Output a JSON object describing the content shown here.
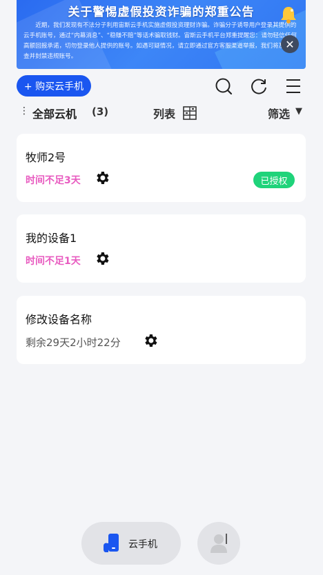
{
  "banner": {
    "title": "关于警惕虚假投资诈骗的郑重公告",
    "body": "近期，我们发现有不法分子利用宙斯云手机实施虚假投资理财诈骗。诈骗分子诱导用户登录其提供的云手机账号，通过“内幕消息”、“稳赚不赔”等话术骗取钱财。宙斯云手机平台郑重提醒您：请勿轻信任何高额回报承诺，切勿登录他人提供的账号。如遇可疑情况，请立即通过官方客服渠道举报，我们将及时核查并封禁违规账号。",
    "close_icon": "close-icon"
  },
  "toolbar": {
    "buy_label": "+ 购买云手机",
    "icons": [
      "search-icon",
      "refresh-icon",
      "menu-icon"
    ]
  },
  "filter_row": {
    "all_label": "全部云机",
    "count": "(3)",
    "view_label": "列表",
    "filter_label": "筛选",
    "filter_arrow": "▼"
  },
  "devices": [
    {
      "name": "牧师2号",
      "time": "时间不足3天",
      "time_color": "#e85bc0",
      "badge": "已授权"
    },
    {
      "name": "我的设备1",
      "time": "时间不足1天",
      "time_color": "#e85bc0",
      "badge": ""
    },
    {
      "name": "修改设备名称",
      "time": "剩余29天2小时22分",
      "time_color": "#555555",
      "badge": ""
    }
  ],
  "bottom_nav": {
    "cloud_phone_label": "云手机",
    "accent": "#1a56f0"
  },
  "colors": {
    "primary": "#1a56f0",
    "warning_pink": "#e85bc0",
    "authorized_green": "#1fd37a"
  }
}
